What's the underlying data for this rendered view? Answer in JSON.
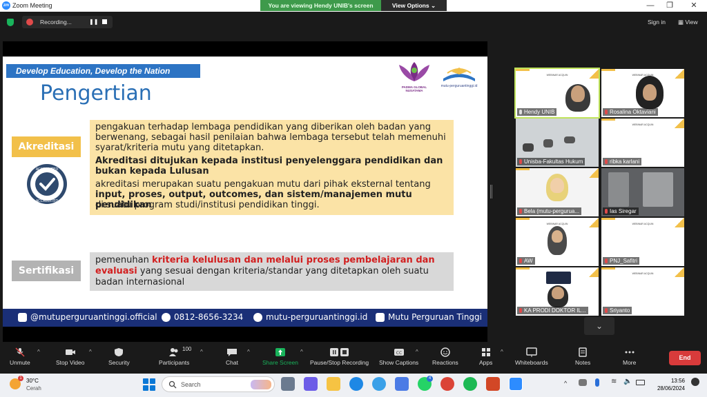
{
  "window": {
    "title": "Zoom Meeting",
    "banner": "You are viewing Hendy UNIB's screen",
    "view_options": "View Options"
  },
  "topbar": {
    "recording_label": "Recording...",
    "signin": "Sign in",
    "view": "View"
  },
  "slide": {
    "slogan": "Develop Education, Develop the Nation",
    "heading": "Pengertian",
    "logo1_text": "PADMA GLOBAL NUSATAMA",
    "logo2_text": "mutu-perguruantinggi.id",
    "akreditasi_tag": "Akreditasi",
    "akreditasi_line1": "pengakuan terhadap lembaga pendidikan yang diberikan oleh badan yang",
    "akreditasi_line2": "berwenang, sebagai hasil penilaian bahwa lembaga tersebut telah memenuhi",
    "akreditasi_line3": "syarat/kriteria mutu yang ditetapkan.",
    "akreditasi_red1": "Akreditasi ditujukan kepada institusi penyelenggara pendidikan dan",
    "akreditasi_red2": "bukan kepada Lulusan",
    "akreditasi_line4": "akreditasi merupakan suatu pengakuan mutu dari pihak eksternal tentang",
    "akreditasi_blue": "input, proses, output, outcomes, dan sistem/manajemen mutu pendidikan",
    "akreditasi_line5": "di suatu program studi/institusi pendidikan tinggi.",
    "badge_text": "ACCREDITED",
    "sertifikasi_tag": "Sertifikasi",
    "sert_prefix": "pemenuhan ",
    "sert_red1": "kriteria kelulusan dan melalui proses pembelajaran dan",
    "sert_red2": "evaluasi",
    "sert_rest1": " yang sesuai dengan kriteria/standar yang ditetapkan oleh suatu",
    "sert_rest2": "badan internasional",
    "footer": {
      "instagram": "@mutuperguruantinggi.official",
      "phone": "0812-8656-3234",
      "website": "mutu-perguruantinggi.id",
      "youtube": "Mutu Perguruan Tinggi"
    }
  },
  "gallery": {
    "mini_title": "WEBINAR ACQUIN",
    "participants": [
      "Hendy UNIB",
      "Rosalina Oktaviani",
      "Unisba-Fakultas Hukum",
      "ribka karlani",
      "Bela (mutu-pergurua...",
      "Ias Siregar",
      "AW",
      "PNJ_Safitri",
      "KA PRODI DOKTOR IL...",
      "Sriyanto"
    ]
  },
  "toolbar": {
    "unmute": "Unmute",
    "stop_video": "Stop Video",
    "security": "Security",
    "participants": "Participants",
    "participants_count": "100",
    "chat": "Chat",
    "share_screen": "Share Screen",
    "pause_stop": "Pause/Stop Recording",
    "captions": "Show Captions",
    "reactions": "Reactions",
    "apps": "Apps",
    "whiteboards": "Whiteboards",
    "notes": "Notes",
    "more": "More",
    "end": "End"
  },
  "taskbar": {
    "temperature": "30°C",
    "condition": "Cerah",
    "weather_badge": "1",
    "search_placeholder": "Search",
    "time": "13:56",
    "date": "28/06/2024",
    "whatsapp_badge": "4"
  },
  "colors": {
    "banner_green": "#3e9a4b",
    "slogan_blue": "#2d74c4",
    "heading_blue": "#2a6fb5",
    "box1_yellow": "#fbe3a6",
    "box2_gray": "#d8d8d8",
    "accent_red": "#d21f1f",
    "footer_navy": "#1a2f77",
    "end_red": "#d83b3b",
    "share_green": "#19b35b"
  }
}
